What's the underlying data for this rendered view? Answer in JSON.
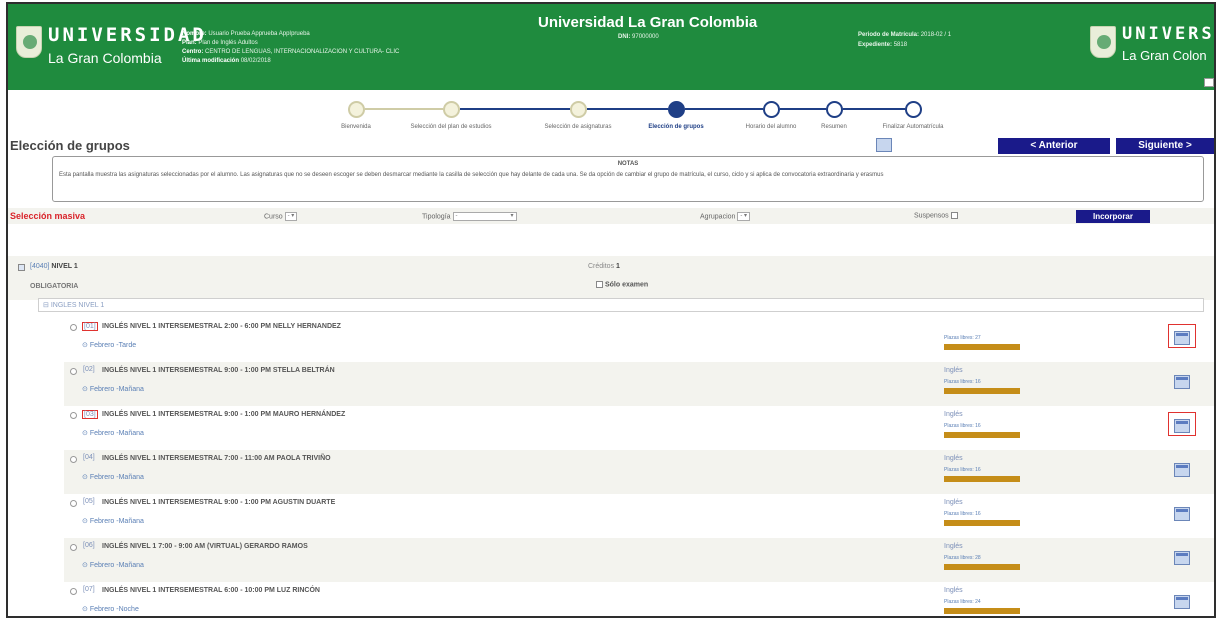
{
  "header": {
    "title": "Universidad La Gran Colombia",
    "logo_big": "UNIVERSIDAD",
    "logo_small": "La Gran Colombia",
    "logo_big_right": "UNIVERSID",
    "logo_small_right": "La Gran Colon",
    "nombre_label": "Nombre:",
    "nombre": "Usuario Prueba Apprueba AppIprueba",
    "plan_label": "Plan:",
    "plan": "Plan de Inglés Adultos",
    "centro_label": "Centro:",
    "centro": "CENTRO DE LENGUAS, INTERNACIONALIZACION Y CULTURA- CLIC",
    "modif_label": "Última modificación",
    "modif": "08/02/2018",
    "dni_label": "DNI:",
    "dni": "97000000",
    "periodo_label": "Periodo de Matrícula:",
    "periodo": "2018-02 / 1",
    "expediente_label": "Expediente:",
    "expediente": "5818"
  },
  "steps": [
    {
      "label": "Bienvenida",
      "state": "done"
    },
    {
      "label": "Selección del plan de estudios",
      "state": "done"
    },
    {
      "label": "Selección de asignaturas",
      "state": "done"
    },
    {
      "label": "Elección de grupos",
      "state": "active"
    },
    {
      "label": "Horario del alumno",
      "state": "todo"
    },
    {
      "label": "Resumen",
      "state": "todo"
    },
    {
      "label": "Finalizar Automatrícula",
      "state": "todo"
    }
  ],
  "page": {
    "title": "Elección de grupos",
    "prev_label": "< Anterior",
    "next_label": "Siguiente >"
  },
  "notes": {
    "title": "NOTAS",
    "text": "Esta pantalla muestra las asignaturas seleccionadas por el alumno. Las asignaturas que no se deseen escoger se deben desmarcar mediante la casilla de selección que hay delante de cada una. Se da opción de cambiar el grupo de matrícula, el curso, ciclo y si aplica de convocatoria extraordinaria y erasmus"
  },
  "mass": {
    "label": "Selección masiva",
    "curso_label": "Curso",
    "curso_value": "-",
    "tipologia_label": "Tipología",
    "tipologia_value": "-",
    "agrupacion_label": "Agrupacion",
    "agrupacion_value": "-",
    "suspensos_label": "Suspensos",
    "incorporar_label": "Incorporar"
  },
  "level": {
    "code": "[4040]",
    "name": "NIVEL 1",
    "credits_label": "Créditos",
    "credits": "1",
    "type": "OBLIGATORIA",
    "exam_label": "Sólo examen",
    "subject": "INGLES NIVEL 1"
  },
  "groups": [
    {
      "code": "[01]",
      "name": "INGLÉS NIVEL 1 INTERSEMESTRAL 2:00 - 6:00 PM NELLY HERNANDEZ",
      "term": "Febrero -Tarde",
      "lang": "",
      "places": "Plazas libres: 27",
      "highlight": true
    },
    {
      "code": "[02]",
      "name": "INGLÉS NIVEL 1 INTERSEMESTRAL 9:00 - 1:00 PM STELLA BELTRÁN",
      "term": "Febrero -Mañana",
      "lang": "Inglés",
      "places": "Plazas libres: 16",
      "highlight": false
    },
    {
      "code": "[03]",
      "name": "INGLÉS NIVEL 1 INTERSEMESTRAL 9:00 - 1:00 PM MAURO HERNÁNDEZ",
      "term": "Febrero -Mañana",
      "lang": "Inglés",
      "places": "Plazas libres: 16",
      "highlight": true
    },
    {
      "code": "[04]",
      "name": "INGLÉS NIVEL 1 INTERSEMESTRAL 7:00 - 11:00 AM PAOLA TRIVIÑO",
      "term": "Febrero -Mañana",
      "lang": "Inglés",
      "places": "Plazas libres: 16",
      "highlight": false
    },
    {
      "code": "[05]",
      "name": "INGLÉS NIVEL 1 INTERSEMESTRAL 9:00 - 1:00 PM AGUSTIN DUARTE",
      "term": "Febrero -Mañana",
      "lang": "Inglés",
      "places": "Plazas libres: 16",
      "highlight": false
    },
    {
      "code": "[06]",
      "name": "INGLÉS NIVEL 1 7:00 - 9:00 AM (VIRTUAL) GERARDO RAMOS",
      "term": "Febrero -Mañana",
      "lang": "Inglés",
      "places": "Plazas libres: 28",
      "highlight": false
    },
    {
      "code": "[07]",
      "name": "INGLÉS NIVEL 1 INTERSEMESTRAL 6:00 - 10:00 PM LUZ RINCÓN",
      "term": "Febrero -Noche",
      "lang": "Inglés",
      "places": "Plazas libres: 24",
      "highlight": false
    }
  ]
}
